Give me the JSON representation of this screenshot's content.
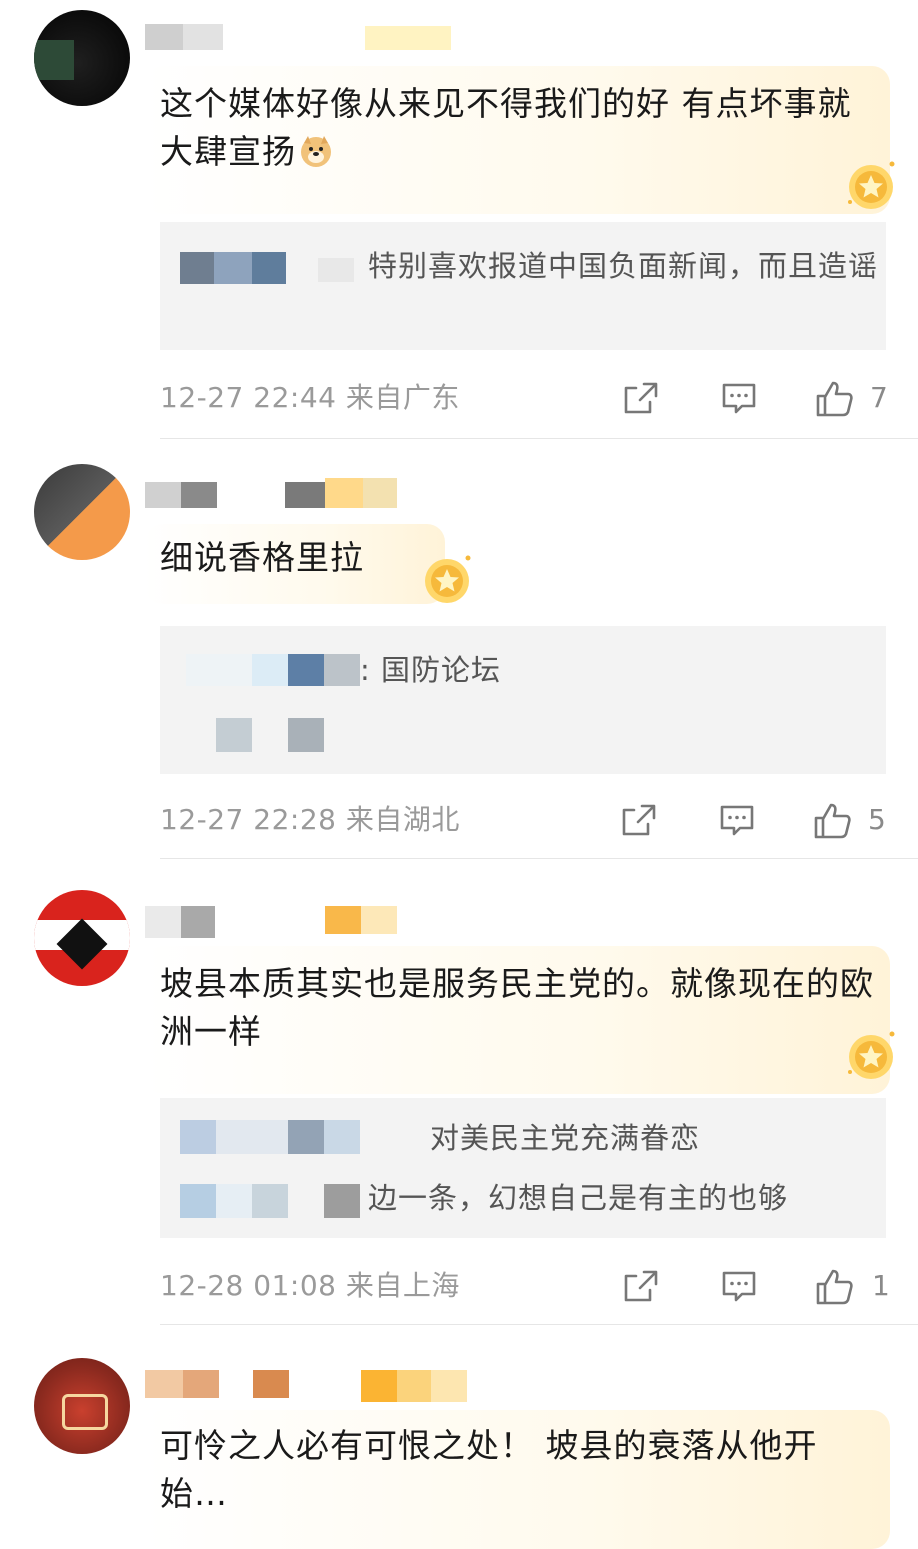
{
  "comments": [
    {
      "text": "这个媒体好像从来见不得我们的好 有点坏事就大肆宣扬",
      "emoji": "doge-emoji",
      "quote": "特别喜欢报道中国负面新闻，而且造谣",
      "time": "12-27 22:44",
      "location": "来自广东",
      "likes": "7"
    },
    {
      "text": "细说香格里拉",
      "quote": ": 国防论坛",
      "time": "12-27 22:28",
      "location": "来自湖北",
      "likes": "5"
    },
    {
      "text": "坡县本质其实也是服务民主党的。就像现在的欧洲一样",
      "quote_line1": "对美民主党充满眷恋",
      "quote_line2": "边一条，幻想自己是有主的也够",
      "time": "12-28 01:08",
      "location": "来自上海",
      "likes": "1"
    },
    {
      "text": "可怜之人必有可恨之处！ 坡县的衰落从他开始…"
    }
  ],
  "icons": {
    "share": "share-icon",
    "reply": "comment-icon",
    "like": "thumbs-up-icon",
    "badge": "star-badge-icon"
  },
  "colors": {
    "accent_gold": "#f5c34a",
    "meta_gray": "#9a9a9a",
    "quote_bg": "#f3f3f3"
  }
}
